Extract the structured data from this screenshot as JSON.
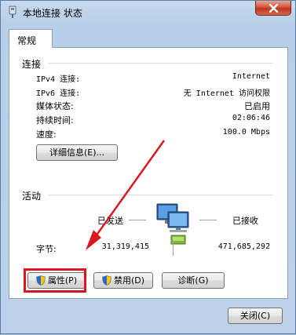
{
  "window": {
    "title": "本地连接 状态"
  },
  "tabs": [
    {
      "label": "常规"
    }
  ],
  "connection": {
    "heading": "连接",
    "rows": [
      {
        "label": "IPv4 连接:",
        "value": "Internet"
      },
      {
        "label": "IPv6 连接:",
        "value": "无 Internet 访问权限"
      },
      {
        "label": "媒体状态:",
        "value": "已启用"
      },
      {
        "label": "持续时间:",
        "value": "02:06:46"
      },
      {
        "label": "速度:",
        "value": "100.0 Mbps"
      }
    ],
    "details_button": "详细信息(E)..."
  },
  "activity": {
    "heading": "活动",
    "sent_label": "已发送",
    "received_label": "已接收",
    "bytes_label": "字节:",
    "bytes_sent": "31,319,415",
    "bytes_received": "471,685,292"
  },
  "buttons": {
    "properties": "属性(P)",
    "disable": "禁用(D)",
    "diagnose": "诊断(G)",
    "close": "关闭(C)"
  },
  "annotation": {
    "highlight_color": "#d9171e",
    "arrow_color": "#d9171e"
  }
}
